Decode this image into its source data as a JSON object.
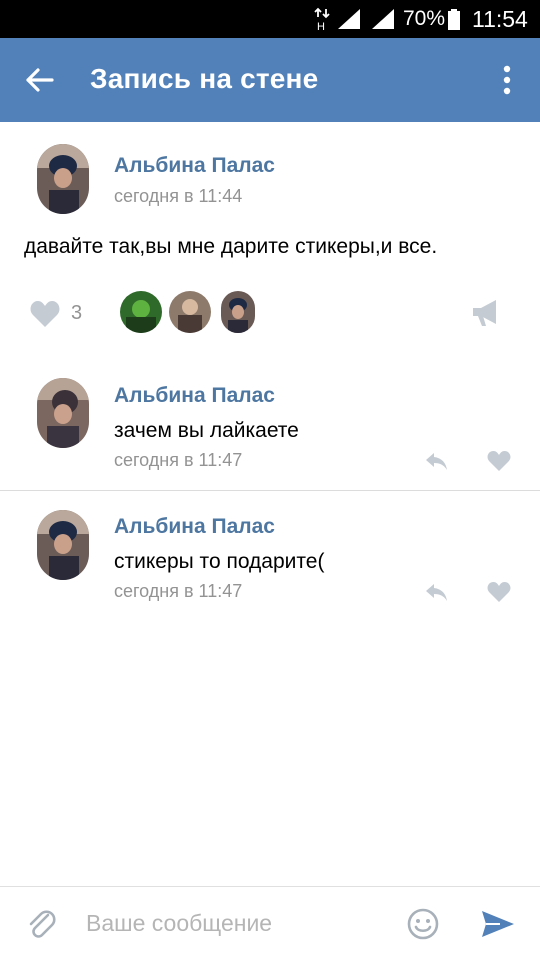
{
  "status_bar": {
    "battery_percent": "70%",
    "time": "11:54",
    "network_letter": "H"
  },
  "header": {
    "title": "Запись на стене",
    "back_icon": "arrow-left-icon",
    "menu_icon": "more-vertical-icon"
  },
  "post": {
    "author": "Альбина Палас",
    "time": "сегодня в 11:44",
    "text": "давайте так,вы мне дарите стикеры,и все.",
    "likes": "3"
  },
  "comments": [
    {
      "author": "Альбина Палас",
      "text": "зачем вы лайкаете",
      "time": "сегодня в 11:47"
    },
    {
      "author": "Альбина Палас",
      "text": "стикеры то подарите(",
      "time": "сегодня в 11:47"
    }
  ],
  "composer": {
    "placeholder": "Ваше сообщение"
  },
  "colors": {
    "header_bg": "#5181b8",
    "link_blue": "#4d76a1",
    "icon_gray": "#c4cbd3",
    "meta_gray": "#939393"
  }
}
